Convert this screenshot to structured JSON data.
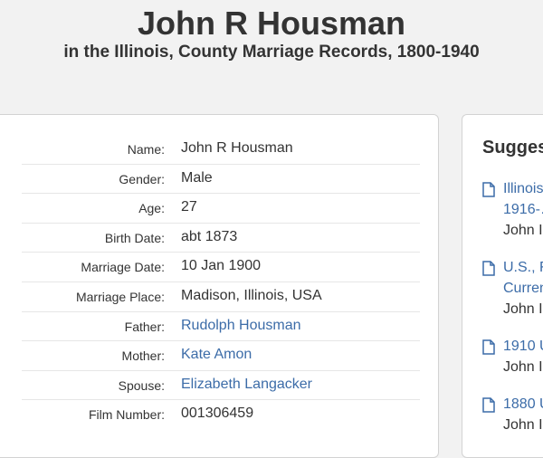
{
  "header": {
    "title": "John R Housman",
    "subtitle": "in the Illinois, County Marriage Records, 1800-1940"
  },
  "record": {
    "rows": [
      {
        "label": "Name:",
        "value": "John R Housman",
        "link": false
      },
      {
        "label": "Gender:",
        "value": "Male",
        "link": false
      },
      {
        "label": "Age:",
        "value": "27",
        "link": false
      },
      {
        "label": "Birth Date:",
        "value": "abt 1873",
        "link": false
      },
      {
        "label": "Marriage Date:",
        "value": "10 Jan 1900",
        "link": false
      },
      {
        "label": "Marriage Place:",
        "value": "Madison, Illinois, USA",
        "link": false
      },
      {
        "label": "Father:",
        "value": "Rudolph Housman",
        "link": true
      },
      {
        "label": "Mother:",
        "value": "Kate Amon",
        "link": true
      },
      {
        "label": "Spouse:",
        "value": "Elizabeth Langacker",
        "link": true
      },
      {
        "label": "Film Number:",
        "value": "001306459",
        "link": false
      }
    ]
  },
  "suggested": {
    "heading": "Sugges",
    "items": [
      {
        "line1": "Illinois",
        "line2": "1916-…",
        "line3": "John I"
      },
      {
        "line1": "U.S., F",
        "line2": "Curren",
        "line3": "John I"
      },
      {
        "line1": "1910 U",
        "line2": "",
        "line3": "John I"
      },
      {
        "line1": "1880 U",
        "line2": "",
        "line3": "John I"
      }
    ]
  },
  "colors": {
    "link": "#3c6ca8",
    "text": "#333333",
    "background": "#f2f2f2",
    "card": "#ffffff"
  },
  "icons": {
    "suggested_item": "document-icon"
  }
}
